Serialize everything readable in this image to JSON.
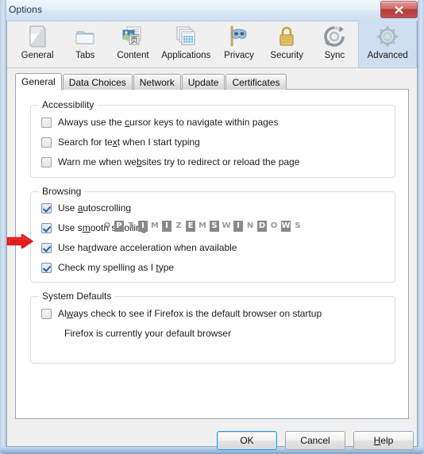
{
  "window": {
    "title": "Options",
    "close_label": "Close",
    "close_icon": "close-x-icon"
  },
  "toolbar": {
    "items": [
      {
        "label": "General",
        "icon": "general-window-icon",
        "selected": false
      },
      {
        "label": "Tabs",
        "icon": "folder-tabs-icon",
        "selected": false
      },
      {
        "label": "Content",
        "icon": "content-document-icon",
        "selected": false
      },
      {
        "label": "Applications",
        "icon": "applications-windows-icon",
        "selected": false
      },
      {
        "label": "Privacy",
        "icon": "privacy-mask-icon",
        "selected": false
      },
      {
        "label": "Security",
        "icon": "security-padlock-icon",
        "selected": false
      },
      {
        "label": "Sync",
        "icon": "sync-arrows-icon",
        "selected": false
      },
      {
        "label": "Advanced",
        "icon": "advanced-gear-icon",
        "selected": true
      }
    ]
  },
  "tabs": [
    {
      "label": "General",
      "active": true
    },
    {
      "label": "Data Choices",
      "active": false
    },
    {
      "label": "Network",
      "active": false
    },
    {
      "label": "Update",
      "active": false
    },
    {
      "label": "Certificates",
      "active": false
    }
  ],
  "groups": {
    "accessibility": {
      "title": "Accessibility",
      "options": [
        {
          "label_pre": "Always use the ",
          "accel": "c",
          "label_post": "ursor keys to navigate within pages",
          "checked": false
        },
        {
          "label_pre": "Search for te",
          "accel": "x",
          "label_post": "t when I start typing",
          "checked": false
        },
        {
          "label_pre": "Warn me when we",
          "accel": "b",
          "label_post": "sites try to redirect or reload the page",
          "checked": false
        }
      ]
    },
    "browsing": {
      "title": "Browsing",
      "options": [
        {
          "label_pre": "Use ",
          "accel": "a",
          "label_post": "utoscrolling",
          "checked": true
        },
        {
          "label_pre": "Use s",
          "accel": "m",
          "label_post": "ooth scrolling",
          "checked": true
        },
        {
          "label_pre": "Use ha",
          "accel": "r",
          "label_post": "dware acceleration when available",
          "checked": true
        },
        {
          "label_pre": "Check my spelling as I ",
          "accel": "t",
          "label_post": "ype",
          "checked": true
        }
      ]
    },
    "system_defaults": {
      "title": "System Defaults",
      "options": [
        {
          "label_pre": "Al",
          "accel": "w",
          "label_post": "ays check to see if Firefox is the default browser on startup",
          "checked": false
        }
      ],
      "status_text": "Firefox is currently your default browser"
    }
  },
  "annotation": {
    "arrow_icon": "red-right-arrow-icon",
    "arrow_color": "#e01b1b",
    "points_at": "Use hardware acceleration when available"
  },
  "watermark": {
    "text": "OPTIMIZEMSWINDOWS",
    "letters": [
      "O",
      "P",
      "T",
      "I",
      "M",
      "I",
      "Z",
      "E",
      "M",
      "S",
      "W",
      "I",
      "N",
      "D",
      "O",
      "W",
      "S"
    ],
    "dark_color": "#8a8a8a",
    "light_color": "#9a9a9a"
  },
  "footer": {
    "ok": {
      "label": "OK",
      "default": true
    },
    "cancel": {
      "label": "Cancel"
    },
    "help": {
      "label_pre": "",
      "accel": "H",
      "label_post": "elp"
    }
  },
  "colors": {
    "selected_tool_bg": "#cfdff1",
    "focus_border": "#2c96d8",
    "checkmark": "#2a63a8",
    "close_red": "#b33b3b"
  }
}
